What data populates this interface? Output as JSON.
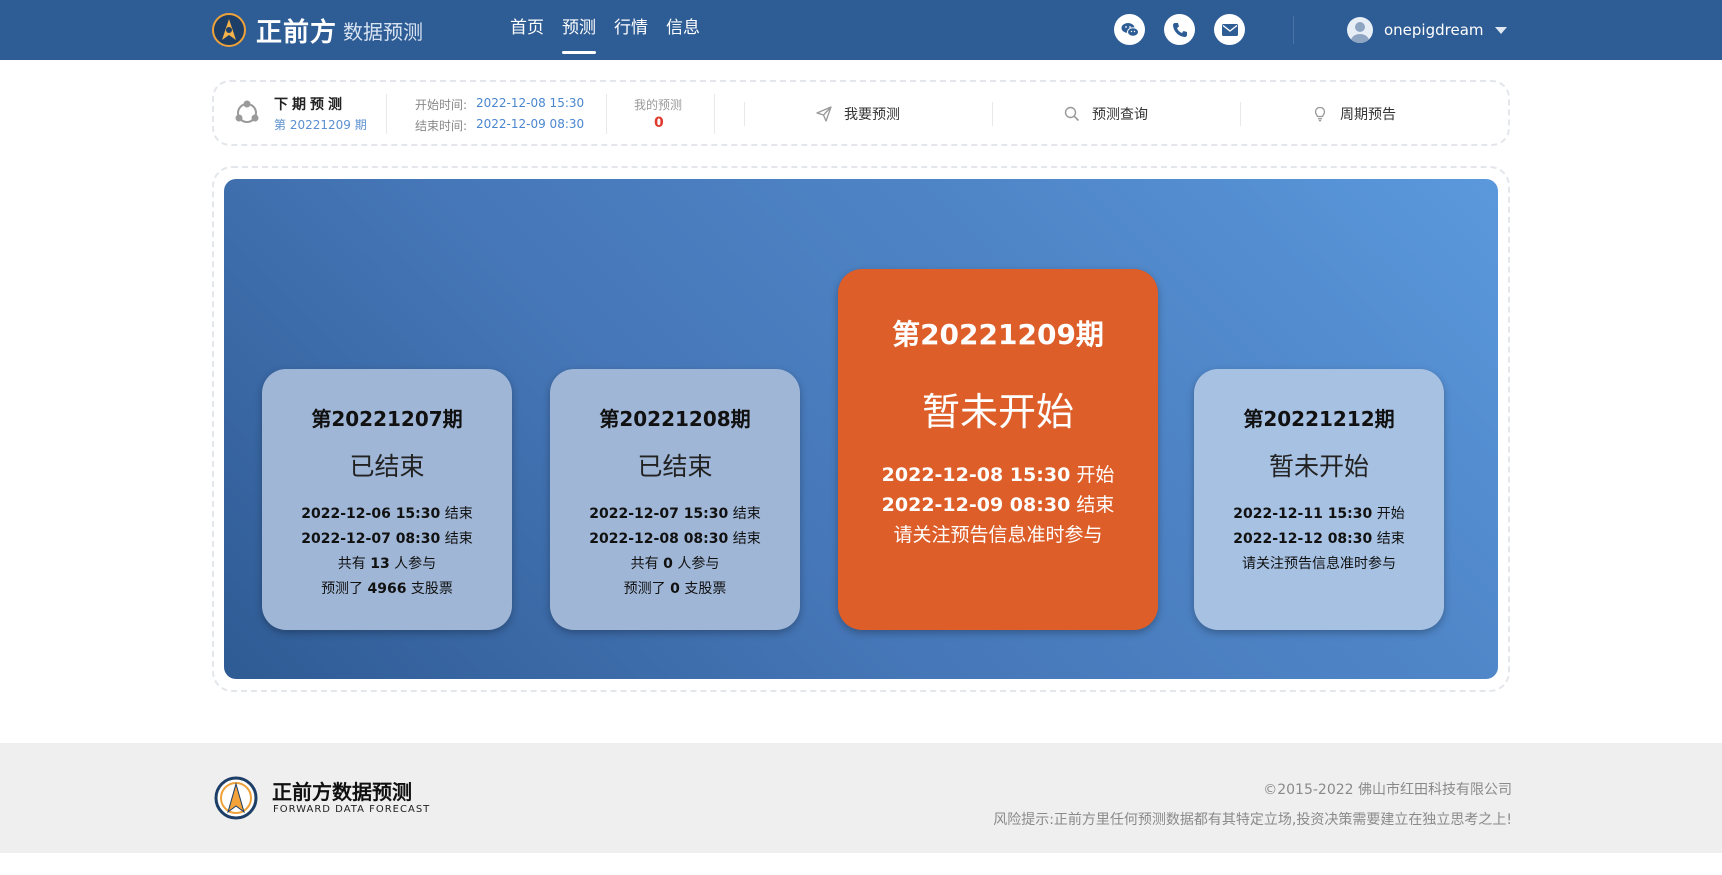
{
  "header": {
    "brand_main": "正前方",
    "brand_sub": "数据预测",
    "nav": [
      "首页",
      "预测",
      "行情",
      "信息"
    ],
    "active_nav": "预测",
    "user_name": "onepigdream"
  },
  "info_bar": {
    "next_title": "下期预测",
    "next_period": "第 20221209 期",
    "start_label": "开始时间:",
    "start_value": "2022-12-08 15:30",
    "end_label": "结束时间:",
    "end_value": "2022-12-09 08:30",
    "my_label": "我的预测",
    "my_value": "0",
    "actions": [
      "我要预测",
      "预测查询",
      "周期预告"
    ]
  },
  "periods": [
    {
      "title": "第20221207期",
      "status": "已结束",
      "line1_time": "2022-12-06 15:30",
      "line1_suffix": " 结束",
      "line2_time": "2022-12-07 08:30",
      "line2_suffix": " 结束",
      "line3_prefix": "共有 ",
      "line3_num": "13",
      "line3_suffix": " 人参与",
      "line4_prefix": "预测了 ",
      "line4_num": "4966",
      "line4_suffix": " 支股票"
    },
    {
      "title": "第20221208期",
      "status": "已结束",
      "line1_time": "2022-12-07 15:30",
      "line1_suffix": " 结束",
      "line2_time": "2022-12-08 08:30",
      "line2_suffix": " 结束",
      "line3_prefix": "共有 ",
      "line3_num": "0",
      "line3_suffix": " 人参与",
      "line4_prefix": "预测了 ",
      "line4_num": "0",
      "line4_suffix": " 支股票"
    },
    {
      "title": "第20221209期",
      "status": "暂未开始",
      "line1_time": "2022-12-08 15:30",
      "line1_suffix": " 开始",
      "line2_time": "2022-12-09 08:30",
      "line2_suffix": " 结束",
      "line3_text": "请关注预告信息准时参与"
    },
    {
      "title": "第20221212期",
      "status": "暂未开始",
      "line1_time": "2022-12-11 15:30",
      "line1_suffix": " 开始",
      "line2_time": "2022-12-12 08:30",
      "line2_suffix": " 结束",
      "line3_text": "请关注预告信息准时参与"
    }
  ],
  "footer": {
    "name": "正前方数据预测",
    "name_en": "FORWARD DATA FORECAST",
    "copyright": "©2015-2022 佛山市红田科技有限公司",
    "risk": "风险提示:正前方里任何预测数据都有其特定立场,投资决策需要建立在独立思考之上!"
  },
  "colors": {
    "nav_bg": "#2e5c94",
    "highlight_card": "#dd5e29",
    "ended_card": "#9fb6d6",
    "future_card": "#a7c1e3",
    "accent_blue": "#4a86cf",
    "count_red": "#e0392d"
  },
  "icons": {
    "contacts": [
      "wechat-icon",
      "phone-icon",
      "mail-icon"
    ],
    "actions": [
      "paper-plane-icon",
      "search-icon",
      "lightbulb-icon"
    ]
  }
}
